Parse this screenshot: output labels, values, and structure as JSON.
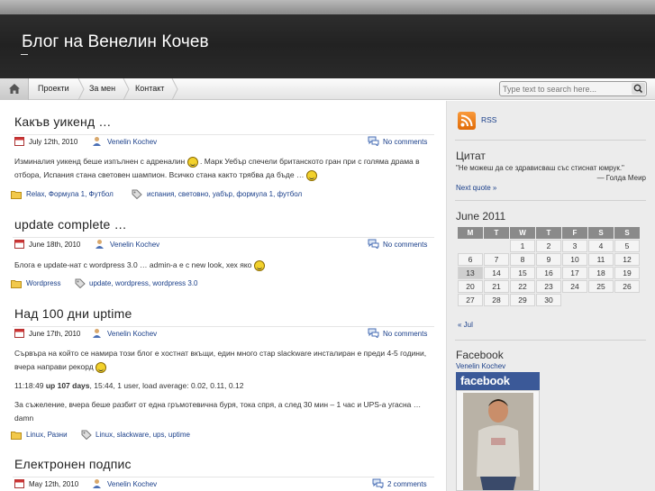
{
  "header": {
    "title": "Блог на Венелин Кочев"
  },
  "nav": {
    "items": [
      "Проекти",
      "За мен",
      "Контакт"
    ]
  },
  "search": {
    "placeholder": "Type text to search here..."
  },
  "posts": [
    {
      "title": "Какъв уикенд …",
      "date": "July 12th, 2010",
      "author": "Venelin Kochev",
      "comments": "No comments",
      "body": [
        "Изминалия уикенд беше изпълнен с адреналин",
        ". Марк Уебър спечели британското гран при с голяма драма в отбора, Испания стана световен шампион. Всичко стана както трябва да бъде …"
      ],
      "categories": "Relax, Формула 1, Футбол",
      "tags": "испания, световно, уабър, формула 1, футбол"
    },
    {
      "title": "update complete …",
      "date": "June 18th, 2010",
      "author": "Venelin Kochev",
      "comments": "No comments",
      "body": [
        "Блога е update-нат с wordpress 3.0 … admin-а е с new look, хех яко"
      ],
      "categories": "Wordpress",
      "tags": "update, wordpress, wordpress 3.0"
    },
    {
      "title": "Над 100 дни uptime",
      "date": "June 17th, 2010",
      "author": "Venelin Kochev",
      "comments": "No comments",
      "body": [
        "Сървъра на който се намира този блог е хостнат вкъщи, един много стар slackware инсталиран е преди 4-5 години, вчера направи рекорд",
        "11:18:49",
        "up 107 days",
        ", 15:44, 1 user, load average: 0.02, 0.11, 0.12",
        "За съжеление, вчера беше разбит от една гръмотевична буря, тока спря, а след 30 мин – 1 час и UPS-а угасна … damn"
      ],
      "categories": "Linux, Разни",
      "tags": "Linux, slackware, ups, uptime"
    },
    {
      "title": "Електронен подпис",
      "date": "May 12th, 2010",
      "author": "Venelin Kochev",
      "comments": "2 comments"
    }
  ],
  "sidebar": {
    "rss": "RSS",
    "quote_title": "Цитат",
    "quote_text": "\"Не можеш да се здрависваш със стиснат юмрук.\"",
    "quote_author": "— Голда Меир",
    "next_quote": "Next quote »",
    "calendar_title": "June 2011",
    "calendar_days": [
      "M",
      "T",
      "W",
      "T",
      "F",
      "S",
      "S"
    ],
    "calendar_weeks": [
      [
        "",
        "",
        "1",
        "2",
        "3",
        "4",
        "5"
      ],
      [
        "6",
        "7",
        "8",
        "9",
        "10",
        "11",
        "12"
      ],
      [
        "13",
        "14",
        "15",
        "16",
        "17",
        "18",
        "19"
      ],
      [
        "20",
        "21",
        "22",
        "23",
        "24",
        "25",
        "26"
      ],
      [
        "27",
        "28",
        "29",
        "30",
        "",
        "",
        ""
      ]
    ],
    "calendar_prev": "« Jul",
    "facebook_title": "Facebook",
    "facebook_name": "Venelin Kochev",
    "facebook_logo": "facebook"
  },
  "icons": [
    "home-icon",
    "search-icon",
    "calendar-icon",
    "user-icon",
    "comment-icon",
    "folder-icon",
    "tag-icon",
    "rss-icon",
    "smiley-icon"
  ],
  "colors": {
    "link": "#1a3f8a",
    "header_bg": "#2a2a2a",
    "facebook": "#3b5998",
    "rss": "#f28a21"
  }
}
